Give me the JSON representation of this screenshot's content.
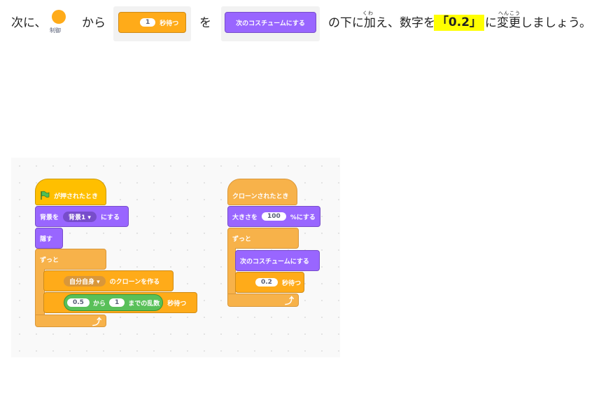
{
  "instruction": {
    "prefix": "次に、",
    "category_label": "制御",
    "kara": "から",
    "wait_block": {
      "value": "1",
      "label": "秒待つ"
    },
    "wo": "を",
    "costume_block": {
      "label": "次のコスチュームにする"
    },
    "suffix1": "の下に加え、数字を",
    "highlight": "「0.2」",
    "suffix2": "に変更しましょう。",
    "ruby_kuwa": "くわ",
    "ruby_henkou": "へんこう"
  },
  "script_left": {
    "hat": "が押されたとき",
    "backdrop_label": "背景を",
    "backdrop_value": "背景1",
    "backdrop_suffix": "にする",
    "hide": "隠す",
    "forever": "ずっと",
    "clone_target": "自分自身",
    "clone_suffix": "のクローンを作る",
    "rand_from": "0.5",
    "rand_kara": "から",
    "rand_to": "1",
    "rand_suffix": "までの乱数",
    "wait_suffix": "秒待つ"
  },
  "script_right": {
    "hat": "クローンされたとき",
    "size_label": "大きさを",
    "size_value": "100",
    "size_suffix": "%にする",
    "forever": "ずっと",
    "next_costume": "次のコスチュームにする",
    "wait_value": "0.2",
    "wait_suffix": "秒待つ"
  },
  "colors": {
    "control": "#ffab19",
    "looks": "#9966ff",
    "events": "#ffbf00",
    "operators": "#59c059",
    "highlight": "#ffff00"
  }
}
